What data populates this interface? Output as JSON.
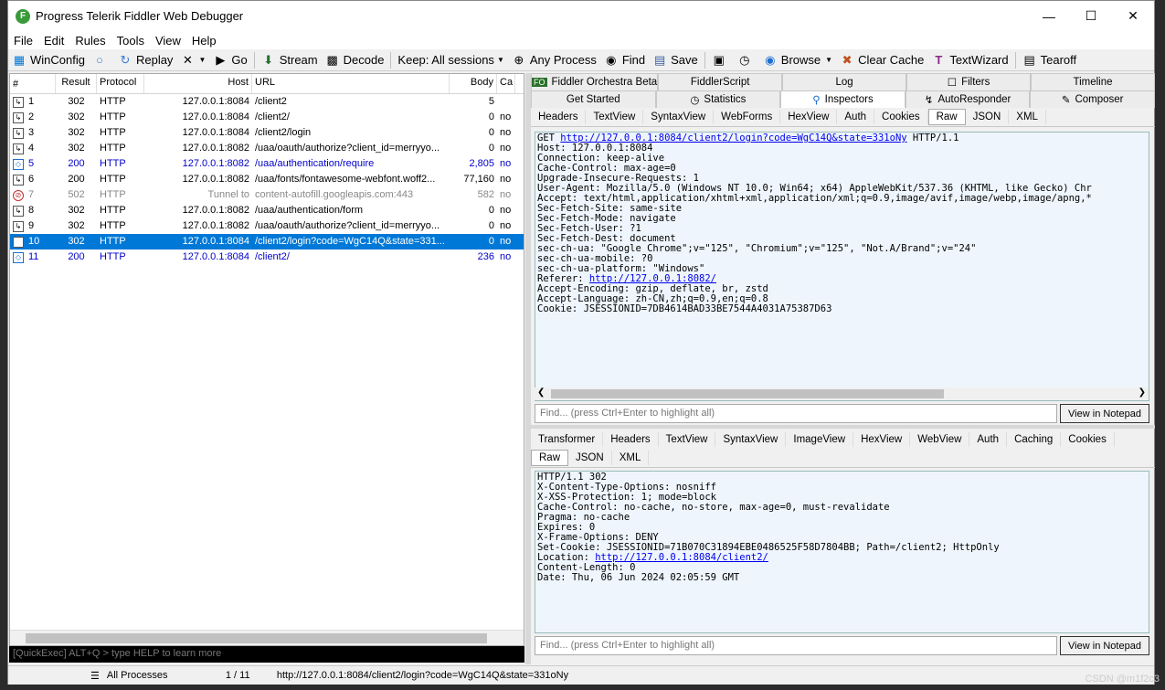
{
  "window": {
    "title": "Progress Telerik Fiddler Web Debugger"
  },
  "menu": [
    "File",
    "Edit",
    "Rules",
    "Tools",
    "View",
    "Help"
  ],
  "toolbar": {
    "winconfig": "WinConfig",
    "replay": "Replay",
    "go": "Go",
    "stream": "Stream",
    "decode": "Decode",
    "keep": "Keep: All sessions",
    "any_process": "Any Process",
    "find": "Find",
    "save": "Save",
    "browse": "Browse",
    "clear_cache": "Clear Cache",
    "textwizard": "TextWizard",
    "tearoff": "Tearoff"
  },
  "sessions": {
    "columns": [
      "#",
      "Result",
      "Protocol",
      "Host",
      "URL",
      "Body",
      "Ca"
    ],
    "rows": [
      {
        "num": "1",
        "result": "302",
        "protocol": "HTTP",
        "host": "127.0.0.1:8084",
        "url": "/client2",
        "body": "5",
        "ca": "",
        "style": "normal"
      },
      {
        "num": "2",
        "result": "302",
        "protocol": "HTTP",
        "host": "127.0.0.1:8084",
        "url": "/client2/",
        "body": "0",
        "ca": "no",
        "style": "normal"
      },
      {
        "num": "3",
        "result": "302",
        "protocol": "HTTP",
        "host": "127.0.0.1:8084",
        "url": "/client2/login",
        "body": "0",
        "ca": "no",
        "style": "normal"
      },
      {
        "num": "4",
        "result": "302",
        "protocol": "HTTP",
        "host": "127.0.0.1:8082",
        "url": "/uaa/oauth/authorize?client_id=merryyo...",
        "body": "0",
        "ca": "no",
        "style": "normal"
      },
      {
        "num": "5",
        "result": "200",
        "protocol": "HTTP",
        "host": "127.0.0.1:8082",
        "url": "/uaa/authentication/require",
        "body": "2,805",
        "ca": "no",
        "style": "blue"
      },
      {
        "num": "6",
        "result": "200",
        "protocol": "HTTP",
        "host": "127.0.0.1:8082",
        "url": "/uaa/fonts/fontawesome-webfont.woff2...",
        "body": "77,160",
        "ca": "no",
        "style": "normal"
      },
      {
        "num": "7",
        "result": "502",
        "protocol": "HTTP",
        "host": "Tunnel to",
        "url": "content-autofill.googleapis.com:443",
        "body": "582",
        "ca": "no",
        "style": "gray"
      },
      {
        "num": "8",
        "result": "302",
        "protocol": "HTTP",
        "host": "127.0.0.1:8082",
        "url": "/uaa/authentication/form",
        "body": "0",
        "ca": "no",
        "style": "normal"
      },
      {
        "num": "9",
        "result": "302",
        "protocol": "HTTP",
        "host": "127.0.0.1:8082",
        "url": "/uaa/oauth/authorize?client_id=merryyo...",
        "body": "0",
        "ca": "no",
        "style": "normal"
      },
      {
        "num": "10",
        "result": "302",
        "protocol": "HTTP",
        "host": "127.0.0.1:8084",
        "url": "/client2/login?code=WgC14Q&state=331...",
        "body": "0",
        "ca": "no",
        "style": "selected"
      },
      {
        "num": "11",
        "result": "200",
        "protocol": "HTTP",
        "host": "127.0.0.1:8084",
        "url": "/client2/",
        "body": "236",
        "ca": "no",
        "style": "blue"
      }
    ]
  },
  "quickexec": "[QuickExec] ALT+Q > type HELP to learn more",
  "right_tabs_top": [
    "Fiddler Orchestra Beta",
    "FiddlerScript",
    "Log",
    "Filters",
    "Timeline"
  ],
  "right_tabs_2": [
    "Get Started",
    "Statistics",
    "Inspectors",
    "AutoResponder",
    "Composer"
  ],
  "request_tabs": [
    "Headers",
    "TextView",
    "SyntaxView",
    "WebForms",
    "HexView",
    "Auth",
    "Cookies",
    "Raw",
    "JSON",
    "XML"
  ],
  "request": {
    "line1_method": "GET",
    "line1_url": "http://127.0.0.1:8084/client2/login?code=WgC14Q&state=331oNy",
    "line1_proto": "HTTP/1.1",
    "lines_a": [
      "Host: 127.0.0.1:8084",
      "Connection: keep-alive",
      "Cache-Control: max-age=0",
      "Upgrade-Insecure-Requests: 1",
      "User-Agent: Mozilla/5.0 (Windows NT 10.0; Win64; x64) AppleWebKit/537.36 (KHTML, like Gecko) Chr",
      "Accept: text/html,application/xhtml+xml,application/xml;q=0.9,image/avif,image/webp,image/apng,*",
      "Sec-Fetch-Site: same-site",
      "Sec-Fetch-Mode: navigate",
      "Sec-Fetch-User: ?1",
      "Sec-Fetch-Dest: document",
      "sec-ch-ua: \"Google Chrome\";v=\"125\", \"Chromium\";v=\"125\", \"Not.A/Brand\";v=\"24\"",
      "sec-ch-ua-mobile: ?0",
      "sec-ch-ua-platform: \"Windows\""
    ],
    "referer_label": "Referer: ",
    "referer_url": "http://127.0.0.1:8082/",
    "lines_b": [
      "Accept-Encoding: gzip, deflate, br, zstd",
      "Accept-Language: zh-CN,zh;q=0.9,en;q=0.8",
      "Cookie: JSESSIONID=7DB4614BAD33BE7544A4031A75387D63"
    ]
  },
  "find_placeholder": "Find... (press Ctrl+Enter to highlight all)",
  "view_notepad": "View in Notepad",
  "response_tabs_1": [
    "Transformer",
    "Headers",
    "TextView",
    "SyntaxView",
    "ImageView",
    "HexView",
    "WebView",
    "Auth",
    "Caching",
    "Cookies"
  ],
  "response_tabs_2": [
    "Raw",
    "JSON",
    "XML"
  ],
  "response": {
    "lines_a": [
      "HTTP/1.1 302",
      "X-Content-Type-Options: nosniff",
      "X-XSS-Protection: 1; mode=block",
      "Cache-Control: no-cache, no-store, max-age=0, must-revalidate",
      "Pragma: no-cache",
      "Expires: 0",
      "X-Frame-Options: DENY",
      "Set-Cookie: JSESSIONID=71B070C31894EBE0486525F58D7804BB; Path=/client2; HttpOnly"
    ],
    "location_label": "Location: ",
    "location_url": "http://127.0.0.1:8084/client2/",
    "lines_b": [
      "Content-Length: 0",
      "Date: Thu, 06 Jun 2024 02:05:59 GMT"
    ]
  },
  "status": {
    "processes": "All Processes",
    "count": "1 / 11",
    "url": "http://127.0.0.1:8084/client2/login?code=WgC14Q&state=331oNy"
  },
  "watermark": "CSDN @m1f2c3"
}
